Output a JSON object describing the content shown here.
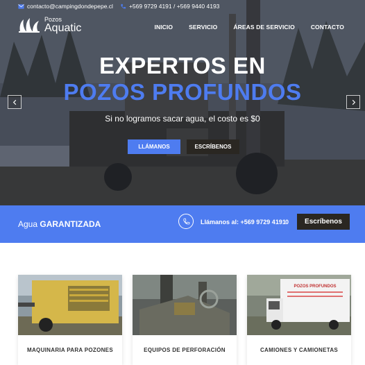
{
  "topbar": {
    "email": "contacto@campingdondepepe.cl",
    "phones": "+569 9729 4191 / +569 9440 4193"
  },
  "logo": {
    "line1": "Pozos",
    "line2": "Aquatic"
  },
  "nav": [
    "INICIO",
    "SERVICIO",
    "ÁREAS DE SERVICIO",
    "CONTACTO"
  ],
  "hero": {
    "title_line1": "EXPERTOS EN",
    "title_line2": "POZOS PROFUNDOS",
    "subtitle": "Si no logramos sacar agua, el costo es $0",
    "button_primary": "LLÁMANOS",
    "button_secondary": "ESCRÍBENOS"
  },
  "band": {
    "lead_normal": "Agua ",
    "lead_bold": "GARANTIZADA",
    "call_text": "Llámanos al: +569 9729 4191",
    "extra": "0",
    "button": "Escríbenos"
  },
  "cards": [
    {
      "caption": "MAQUINARIA PARA POZONES"
    },
    {
      "caption": "EQUIPOS DE PERFORACIÓN"
    },
    {
      "caption": "CAMIONES Y CAMIONETAS"
    }
  ],
  "truck_sign": "POZOS PROFUNDOS",
  "colors": {
    "accent": "#4e7cf0",
    "dark_button": "#2a2722"
  }
}
